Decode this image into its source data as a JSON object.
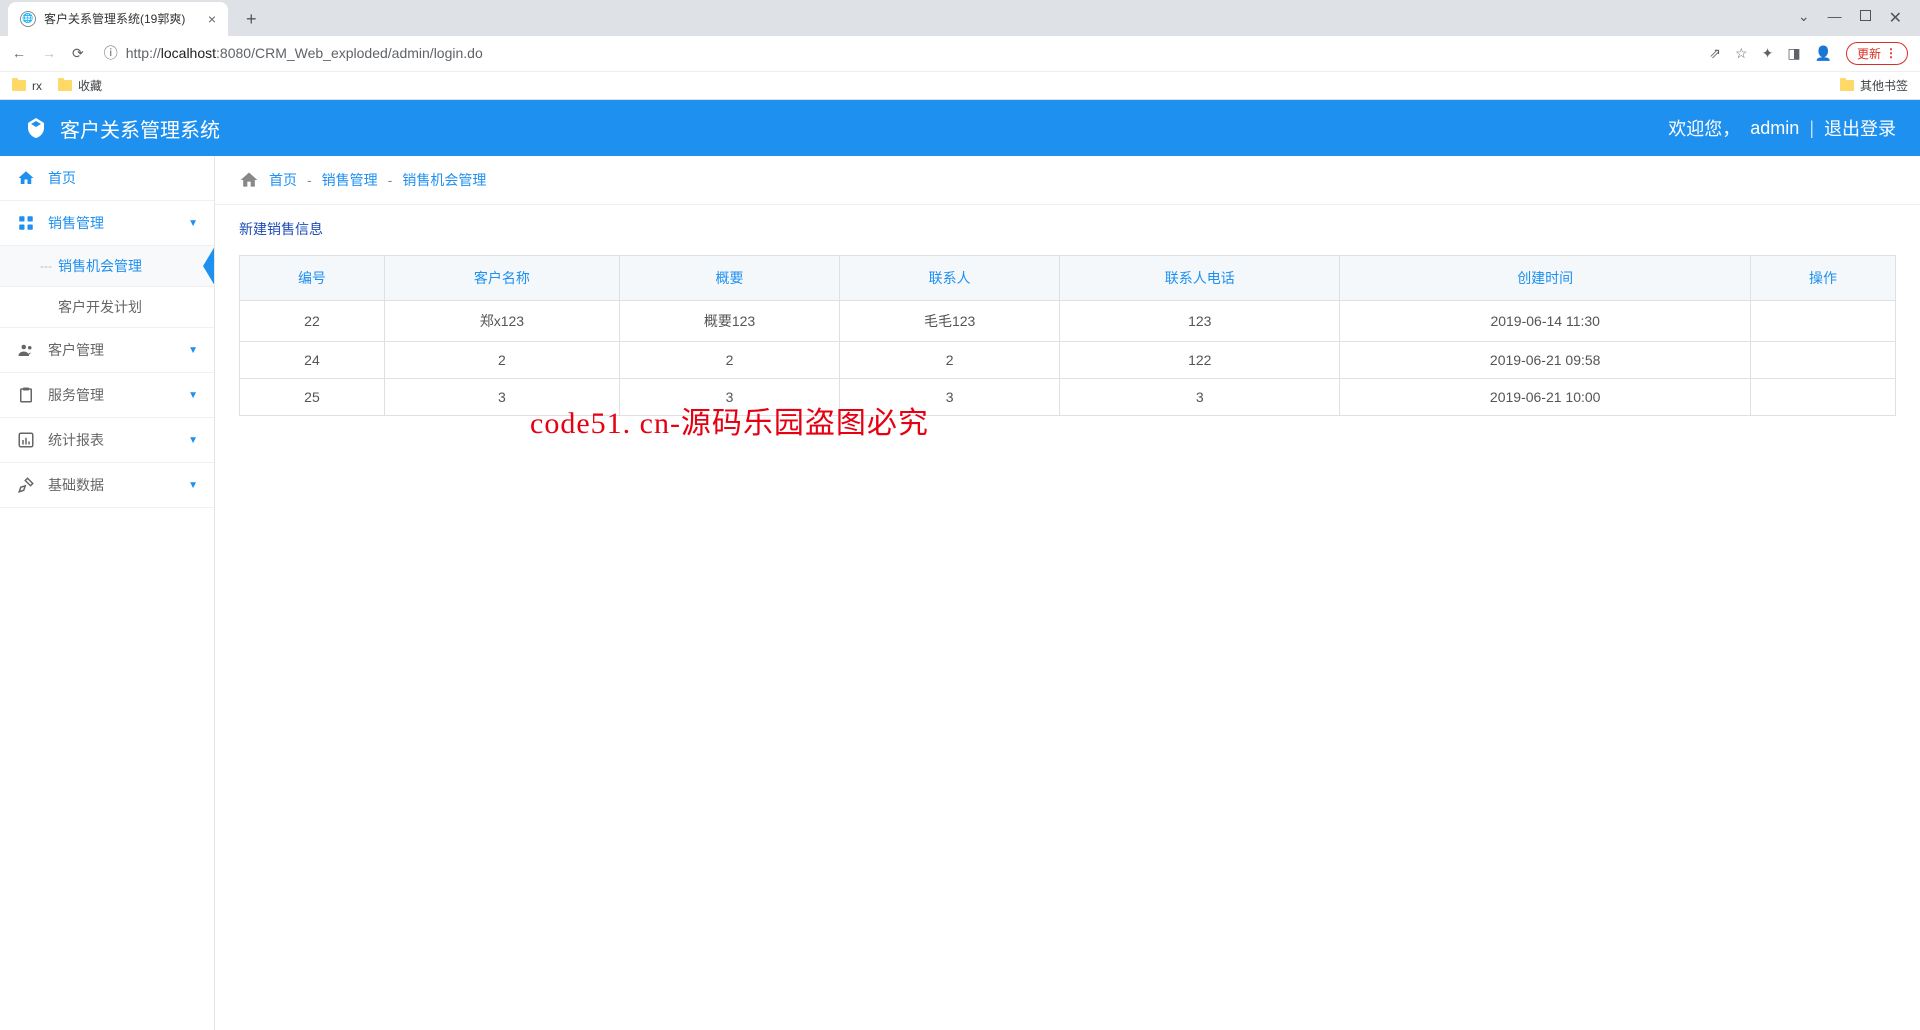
{
  "browser": {
    "tab_title": "客户关系管理系统(19郭爽)",
    "url_prefix": "http://",
    "url_host": "localhost",
    "url_port": ":8080",
    "url_path": "/CRM_Web_exploded/admin/login.do",
    "update_label": "更新",
    "bookmarks": [
      "rx",
      "收藏"
    ],
    "other_bookmarks": "其他书签"
  },
  "header": {
    "app_name": "客户关系管理系统",
    "welcome": "欢迎您，",
    "username": "admin",
    "logout": "退出登录"
  },
  "sidebar": {
    "home": "首页",
    "items": [
      {
        "label": "销售管理",
        "expanded": true
      },
      {
        "label": "客户管理",
        "expanded": false
      },
      {
        "label": "服务管理",
        "expanded": false
      },
      {
        "label": "统计报表",
        "expanded": false
      },
      {
        "label": "基础数据",
        "expanded": false
      }
    ],
    "sales_sub": [
      {
        "label": "销售机会管理",
        "active": true
      },
      {
        "label": "客户开发计划",
        "active": false
      }
    ]
  },
  "breadcrumb": {
    "home": "首页",
    "section": "销售管理",
    "page": "销售机会管理"
  },
  "content": {
    "new_record": "新建销售信息",
    "columns": [
      "编号",
      "客户名称",
      "概要",
      "联系人",
      "联系人电话",
      "创建时间",
      "操作"
    ],
    "rows": [
      {
        "id": "22",
        "customer": "郑x123",
        "summary": "概要123",
        "contact": "毛毛123",
        "phone": "123",
        "created": "2019-06-14 11:30"
      },
      {
        "id": "24",
        "customer": "2",
        "summary": "2",
        "contact": "2",
        "phone": "122",
        "created": "2019-06-21 09:58"
      },
      {
        "id": "25",
        "customer": "3",
        "summary": "3",
        "contact": "3",
        "phone": "3",
        "created": "2019-06-21 10:00"
      }
    ]
  },
  "watermark": "code51. cn-源码乐园盗图必究"
}
